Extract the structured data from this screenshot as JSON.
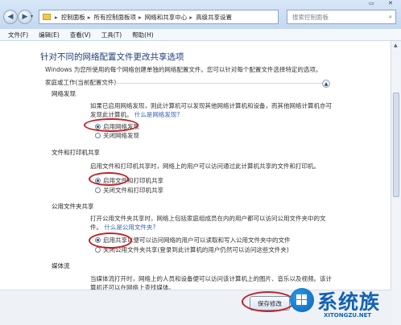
{
  "window": {
    "controls": [
      "▭",
      "✕"
    ]
  },
  "address_bar": {
    "crumbs": [
      "控制面板",
      "所有控制面板项",
      "网络和共享中心",
      "高级共享设置"
    ],
    "search_placeholder": "搜索控制面板"
  },
  "menu": [
    "文件(F)",
    "编辑(E)",
    "查看(V)",
    "工具(T)",
    "帮助(H)"
  ],
  "page": {
    "title": "针对不同的网络配置文件更改共享选项",
    "description": "Windows 为您所使用的每个网络创建单独的网络配置文件。您可以针对每个配置文件选择特定的选项。",
    "profile_heading": "家庭或工作(当前配置文件)"
  },
  "sections": {
    "discovery": {
      "heading": "网络发现",
      "text": "如果已启用网络发现，则此计算机可以发现其他网络计算机和设备，而其他网络计算机亦可发现此计算机。",
      "link": "什么是网络发现?",
      "options": [
        "启用网络发现",
        "关闭网络发现"
      ]
    },
    "file_sharing": {
      "heading": "文件和打印机共享",
      "text": "启用文件和打印机共享时，网络上的用户可以访问通过此计算机共享的文件和打印机。",
      "options": [
        "启用文件和打印机共享",
        "关闭文件和打印机共享"
      ]
    },
    "public_sharing": {
      "heading": "公用文件夹共享",
      "text": "打开公用文件夹共享时，网络上包括家庭组成员在内的用户都可以访问公用文件夹中的文件。",
      "link": "什么是公用文件夹?",
      "options": [
        "启用共享以便可以访问网络的用户可以读取和写入公用文件夹中的文件",
        "关闭公用文件夹共享(登录到此计算机的用户仍然可以访问这些文件夹)"
      ]
    },
    "media": {
      "heading": "媒体流",
      "text": "当媒体流打开时，网络上的人员和设备便可以访问该计算机上的图片、音乐以及视频。该计算机还可以在网络上查找媒体。"
    }
  },
  "buttons": {
    "save": "保存修改"
  },
  "watermark": {
    "brand": "系统族",
    "url": "XITONGZU.NET"
  }
}
